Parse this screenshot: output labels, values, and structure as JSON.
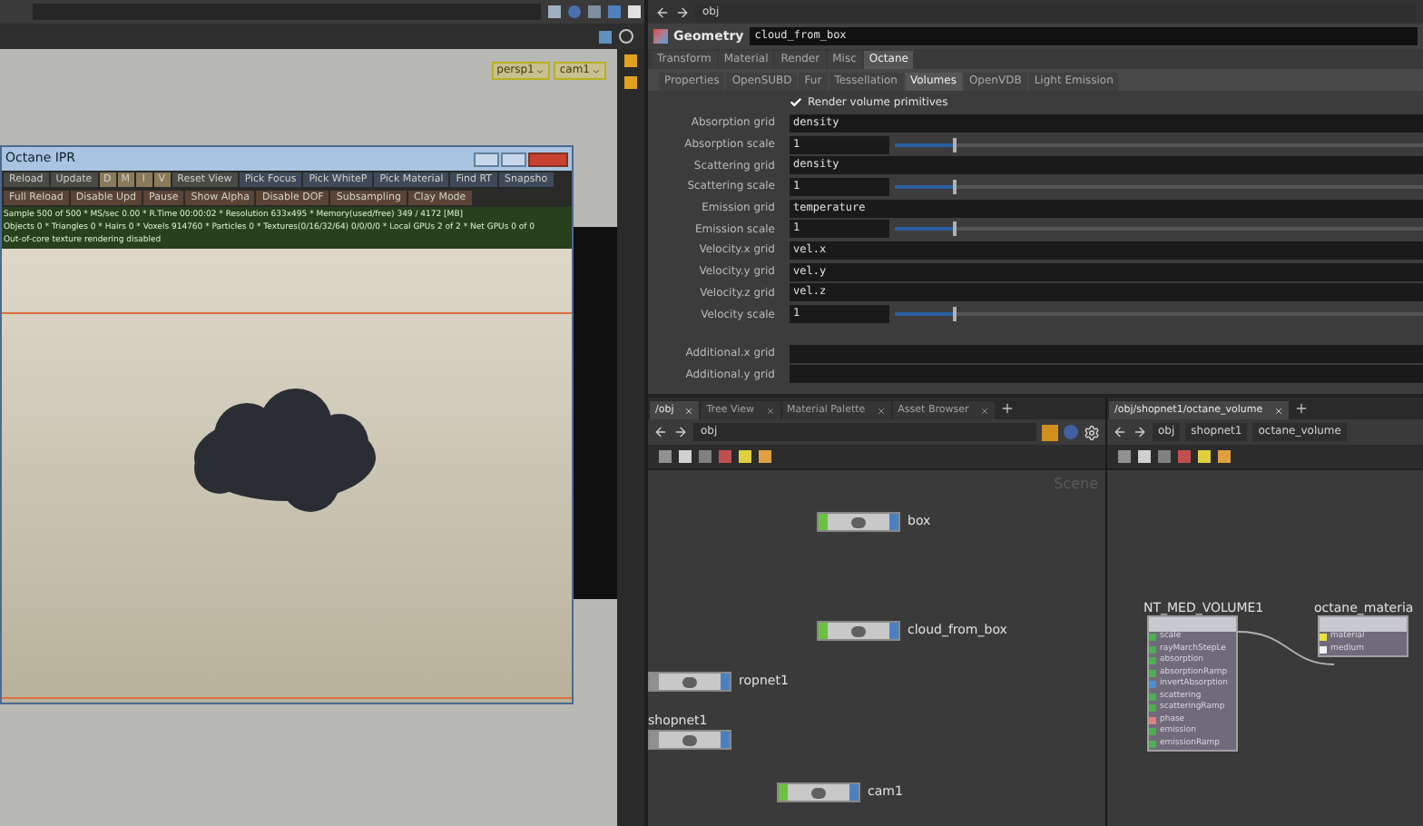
{
  "viewport": {
    "camera_menus": [
      "persp1",
      "cam1"
    ]
  },
  "ipr_window": {
    "title": "Octane IPR",
    "toolbar_rows": [
      [
        {
          "label": "Reload",
          "kind": "action"
        },
        {
          "label": "Update",
          "kind": "action"
        },
        {
          "label": "D",
          "kind": "toggle"
        },
        {
          "label": "M",
          "kind": "toggle"
        },
        {
          "label": "I",
          "kind": "toggle"
        },
        {
          "label": "V",
          "kind": "toggle"
        },
        {
          "label": "Reset View",
          "kind": "action"
        },
        {
          "label": "Pick Focus",
          "kind": "pick"
        },
        {
          "label": "Pick WhiteP",
          "kind": "pick"
        },
        {
          "label": "Pick Material",
          "kind": "pick"
        },
        {
          "label": "Find RT",
          "kind": "pick"
        },
        {
          "label": "Snapsho",
          "kind": "pick"
        }
      ],
      [
        {
          "label": "Full Reload",
          "kind": "mode"
        },
        {
          "label": "Disable Upd",
          "kind": "mode"
        },
        {
          "label": "Pause",
          "kind": "mode"
        },
        {
          "label": "Show Alpha",
          "kind": "mode"
        },
        {
          "label": "Disable DOF",
          "kind": "mode"
        },
        {
          "label": "Subsampling",
          "kind": "mode"
        },
        {
          "label": "Clay Mode",
          "kind": "mode"
        }
      ]
    ],
    "status_lines": [
      "Sample 500 of 500 * MS/sec 0.00 * R.Time 00:00:02 * Resolution 633x495 * Memory(used/free) 349 / 4172 [MB]",
      "Objects 0 * Triangles 0 * Hairs 0 * Voxels 914760 * Particles 0 * Textures(0/16/32/64) 0/0/0/0 * Local GPUs 2 of 2 * Net GPUs 0 of 0",
      "Out-of-core texture rendering disabled"
    ]
  },
  "path_bar": {
    "path": "obj"
  },
  "parameter_editor": {
    "node_type": "Geometry",
    "node_name": "cloud_from_box",
    "tabs": [
      {
        "label": "Transform",
        "selected": false
      },
      {
        "label": "Material",
        "selected": false
      },
      {
        "label": "Render",
        "selected": false
      },
      {
        "label": "Misc",
        "selected": false
      },
      {
        "label": "Octane",
        "selected": true
      }
    ],
    "subtabs": [
      {
        "label": "Properties",
        "selected": false
      },
      {
        "label": "OpenSUBD",
        "selected": false
      },
      {
        "label": "Fur",
        "selected": false
      },
      {
        "label": "Tessellation",
        "selected": false
      },
      {
        "label": "Volumes",
        "selected": true
      },
      {
        "label": "OpenVDB",
        "selected": false
      },
      {
        "label": "Light Emission",
        "selected": false
      }
    ],
    "parameters": [
      {
        "kind": "checkbox",
        "label": "Render volume primitives",
        "checked": true
      },
      {
        "kind": "text",
        "label": "Absorption grid",
        "value": "density"
      },
      {
        "kind": "slider",
        "label": "Absorption scale",
        "value": "1",
        "level": 0.11
      },
      {
        "kind": "text",
        "label": "Scattering grid",
        "value": "density"
      },
      {
        "kind": "slider",
        "label": "Scattering scale",
        "value": "1",
        "level": 0.11
      },
      {
        "kind": "text",
        "label": "Emission grid",
        "value": "temperature"
      },
      {
        "kind": "slider",
        "label": "Emission scale",
        "value": "1",
        "level": 0.11
      },
      {
        "kind": "text",
        "label": "Velocity.x grid",
        "value": "vel.x"
      },
      {
        "kind": "text",
        "label": "Velocity.y grid",
        "value": "vel.y"
      },
      {
        "kind": "text",
        "label": "Velocity.z grid",
        "value": "vel.z"
      },
      {
        "kind": "slider",
        "label": "Velocity scale",
        "value": "1",
        "level": 0.11
      },
      {
        "kind": "gap"
      },
      {
        "kind": "text",
        "label": "Additional.x grid"
      },
      {
        "kind": "text",
        "label": "Additional.y grid"
      }
    ]
  },
  "network_left": {
    "tabs": [
      {
        "label": "/obj",
        "selected": true
      },
      {
        "label": "Tree View",
        "selected": false
      },
      {
        "label": "Material Palette",
        "selected": false
      },
      {
        "label": "Asset Browser",
        "selected": false
      }
    ],
    "path": "obj",
    "canvas_label": "Scene",
    "nodes": [
      {
        "name": "box",
        "kind": "geo"
      },
      {
        "name": "cloud_from_box",
        "kind": "geo"
      },
      {
        "name": "ropnet1",
        "kind": "rop"
      },
      {
        "name": "shopnet1",
        "kind": "shop"
      },
      {
        "name": "cam1",
        "kind": "cam"
      }
    ]
  },
  "network_right": {
    "tabs": [
      {
        "label": "/obj/shopnet1/octane_volume",
        "selected": true
      }
    ],
    "breadcrumb": [
      "obj",
      "shopnet1",
      "octane_volume"
    ],
    "nodes": [
      {
        "name": "NT_MED_VOLUME1",
        "inputs": [
          {
            "name": "scale",
            "color": "#4caf50"
          },
          {
            "name": "rayMarchStepLe",
            "color": "#4caf50"
          },
          {
            "name": "absorption",
            "color": "#4caf50"
          },
          {
            "name": "absorptionRamp",
            "color": "#4caf50"
          },
          {
            "name": "invertAbsorption",
            "color": "#4a8fd0"
          },
          {
            "name": "scattering",
            "color": "#4caf50"
          },
          {
            "name": "scatteringRamp",
            "color": "#4caf50"
          },
          {
            "name": "phase",
            "color": "#e08080"
          },
          {
            "name": "emission",
            "color": "#4caf50"
          },
          {
            "name": "emissionRamp",
            "color": "#4caf50"
          }
        ]
      },
      {
        "name": "octane_materia",
        "inputs": [
          {
            "name": "material",
            "color": "#e8e040"
          },
          {
            "name": "medium",
            "color": "#f0f0f0"
          }
        ]
      }
    ]
  }
}
